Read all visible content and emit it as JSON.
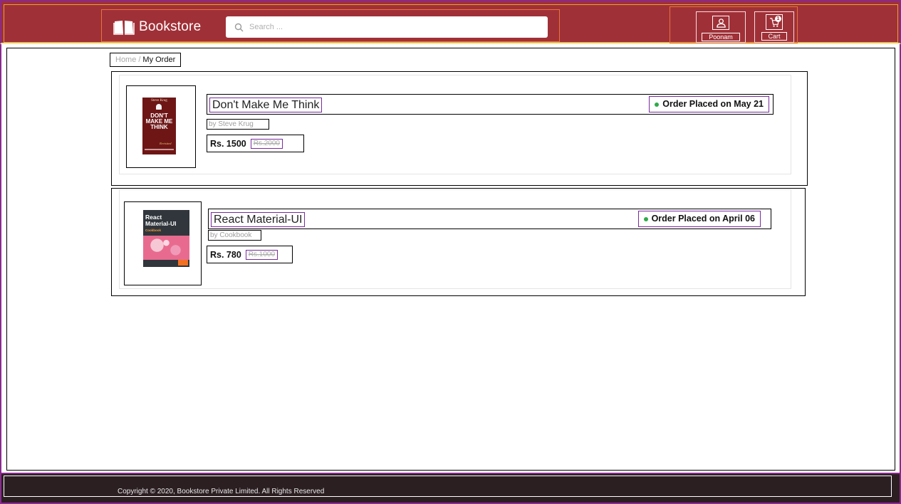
{
  "header": {
    "brand": "Bookstore",
    "search_placeholder": "Search ...",
    "user_label": "Poonam",
    "cart_label": "Cart",
    "cart_count": "1",
    "brand_color": "#a03037"
  },
  "breadcrumb": {
    "home": "Home",
    "separator": "/",
    "current": "My Order"
  },
  "orders": [
    {
      "title": "Don't Make Me Think",
      "author": "by Steve Krug",
      "price": "Rs. 1500",
      "original_price": "Rs.2000",
      "status": "Order Placed on May 21",
      "cover": {
        "top_text": "Steve Krug",
        "main_text": "DON'T MAKE ME THINK",
        "sub_text": "Revisited"
      }
    },
    {
      "title": "React Material-UI",
      "author": "by Cookbook",
      "price": "Rs. 780",
      "original_price": "Rs.1000",
      "status": "Order Placed on April 06",
      "cover": {
        "main_text": "React Material-UI",
        "sub_text": "Cookbook"
      }
    }
  ],
  "footer": {
    "copyright": "Copyright © 2020, Bookstore Private Limited. All Rights Reserved"
  },
  "colors": {
    "status_dot": "#2eaa4a",
    "footer_bg": "#2b1f22"
  }
}
